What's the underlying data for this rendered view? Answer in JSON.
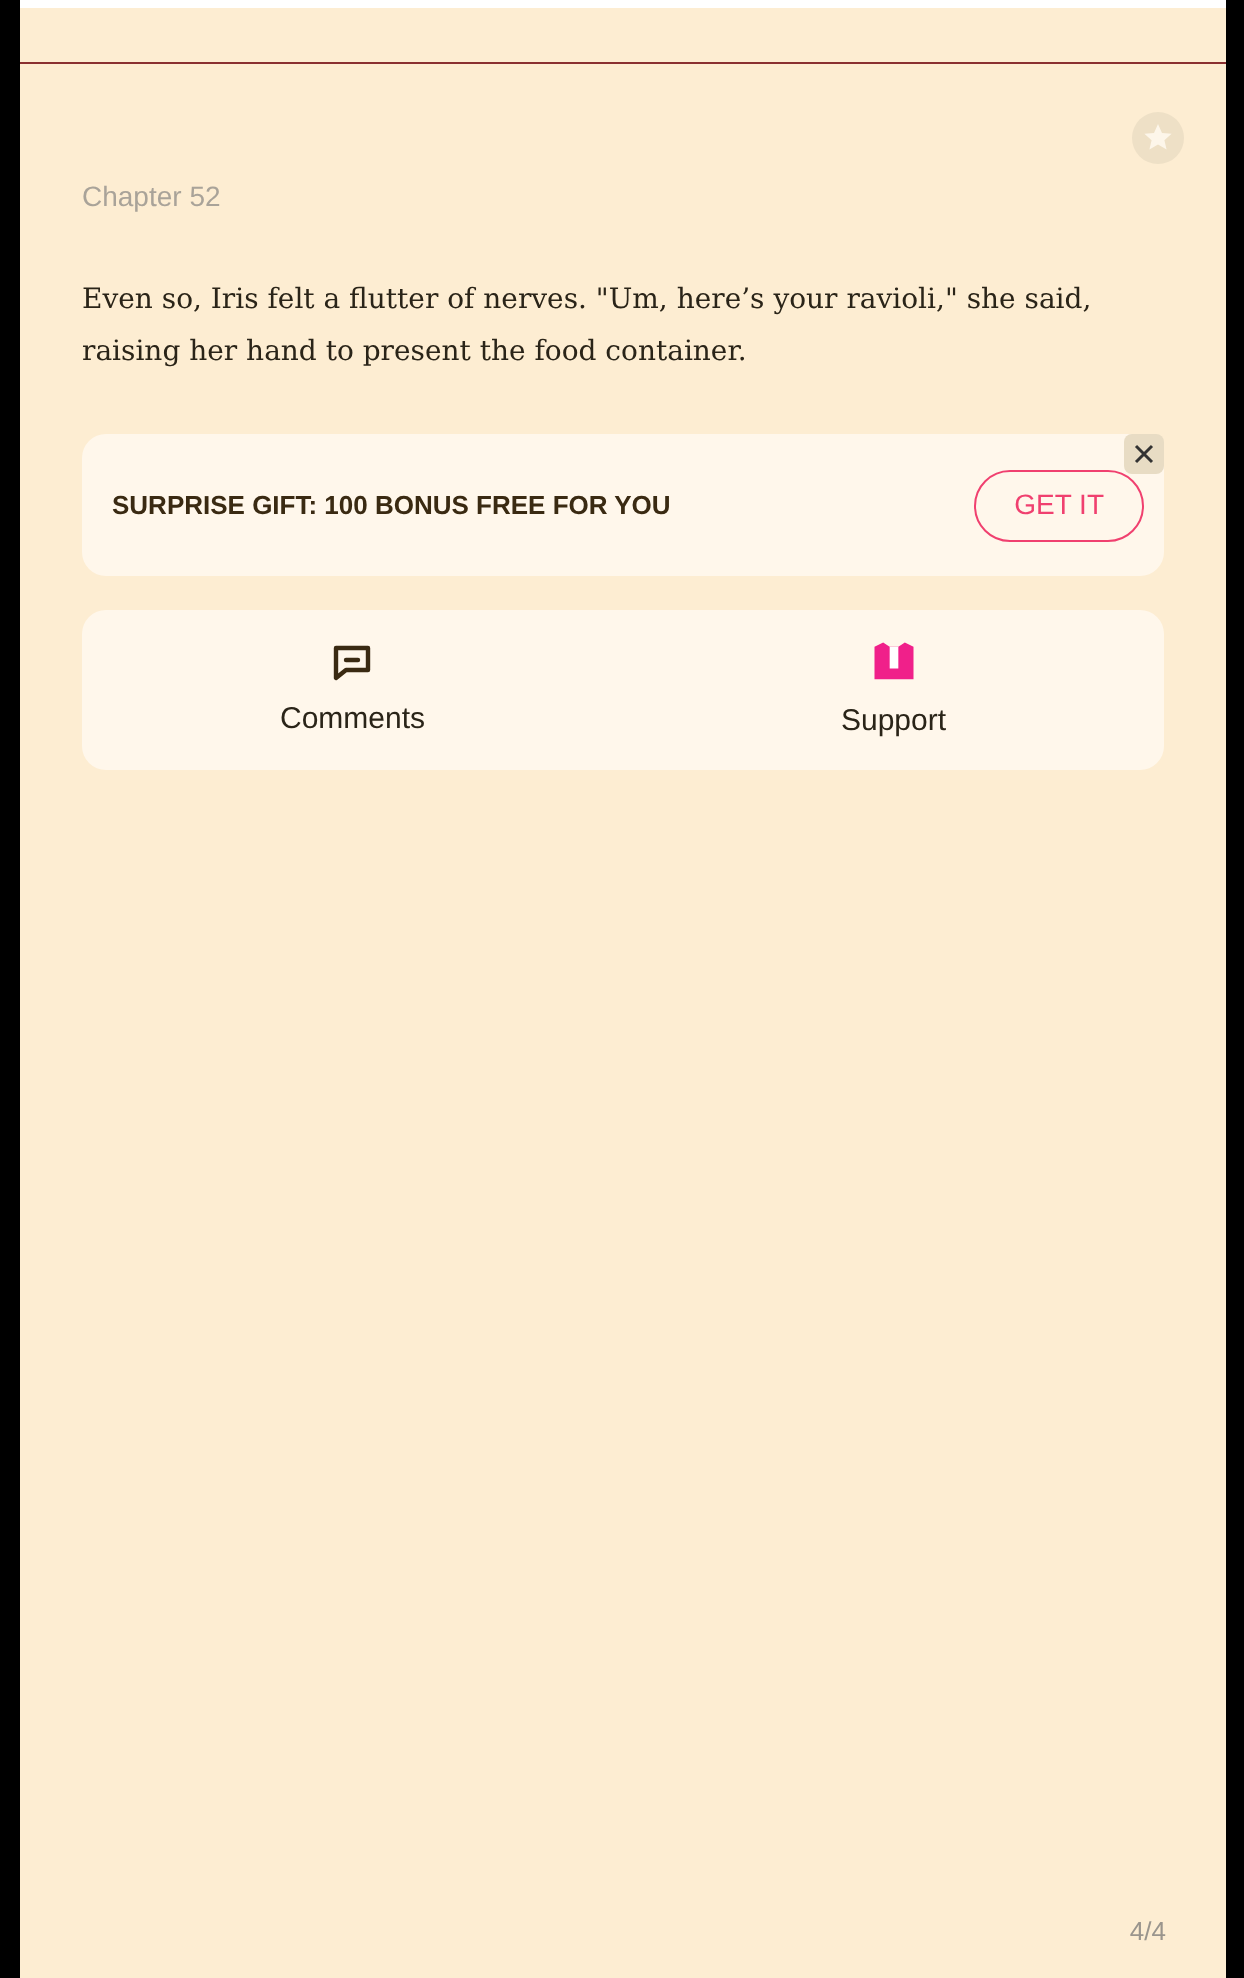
{
  "chapter": {
    "title": "Chapter 52",
    "text": "Even so, Iris felt a flutter of nerves. \"Um, here’s your ravioli,\" she said, raising her hand to present the food container."
  },
  "promo": {
    "text": "SURPRISE GIFT: 100 BONUS FREE FOR YOU",
    "button": "GET IT"
  },
  "actions": [
    {
      "label": "Comments",
      "kind": "comments"
    },
    {
      "label": "Support",
      "kind": "support"
    }
  ],
  "page_indicator": "4/4"
}
